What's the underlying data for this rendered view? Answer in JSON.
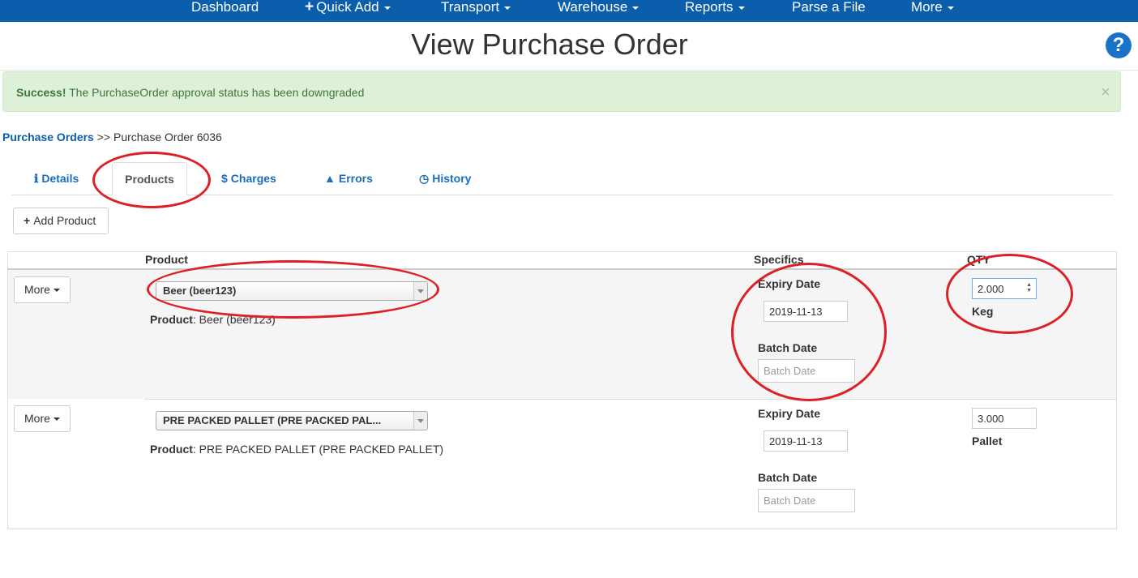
{
  "nav": {
    "dashboard": "Dashboard",
    "quick_add": "Quick Add",
    "transport": "Transport",
    "warehouse": "Warehouse",
    "reports": "Reports",
    "parse_file": "Parse a File",
    "more": "More"
  },
  "page": {
    "title": "View Purchase Order",
    "help": "?"
  },
  "alert": {
    "strong": "Success!",
    "message": "The PurchaseOrder approval status has been downgraded",
    "close": "×"
  },
  "breadcrumb": {
    "link": "Purchase Orders",
    "separator": ">>",
    "current": "Purchase Order 6036"
  },
  "tabs": {
    "details": "Details",
    "products": "Products",
    "charges": "Charges",
    "errors": "Errors",
    "history": "History"
  },
  "add_product": "Add Product",
  "table": {
    "headers": {
      "product": "Product",
      "specifics": "Specifics",
      "qty": "QTY"
    },
    "rows": [
      {
        "more": "More",
        "select": "Beer (beer123)",
        "product_key": "Product",
        "product_value": "Beer (beer123)",
        "expiry_label": "Expiry Date",
        "expiry_value": "2019-11-13",
        "batch_label": "Batch Date",
        "batch_placeholder": "Batch Date",
        "qty": "2.000",
        "unit": "Keg"
      },
      {
        "more": "More",
        "select": "PRE PACKED PALLET (PRE PACKED PAL...",
        "product_key": "Product",
        "product_value": "PRE PACKED PALLET (PRE PACKED PALLET)",
        "expiry_label": "Expiry Date",
        "expiry_value": "2019-11-13",
        "batch_label": "Batch Date",
        "batch_placeholder": "Batch Date",
        "qty": "3.000",
        "unit": "Pallet"
      }
    ]
  },
  "colors": {
    "nav": "#0b5eab",
    "success_bg": "#dff0d8",
    "annotation": "#dd1f26"
  }
}
